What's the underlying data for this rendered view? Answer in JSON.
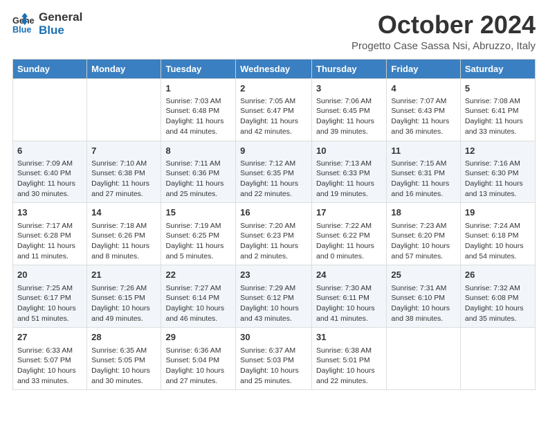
{
  "logo": {
    "line1": "General",
    "line2": "Blue"
  },
  "title": "October 2024",
  "subtitle": "Progetto Case Sassa Nsi, Abruzzo, Italy",
  "days_of_week": [
    "Sunday",
    "Monday",
    "Tuesday",
    "Wednesday",
    "Thursday",
    "Friday",
    "Saturday"
  ],
  "weeks": [
    [
      {
        "day": "",
        "info": ""
      },
      {
        "day": "",
        "info": ""
      },
      {
        "day": "1",
        "info": "Sunrise: 7:03 AM\nSunset: 6:48 PM\nDaylight: 11 hours and 44 minutes."
      },
      {
        "day": "2",
        "info": "Sunrise: 7:05 AM\nSunset: 6:47 PM\nDaylight: 11 hours and 42 minutes."
      },
      {
        "day": "3",
        "info": "Sunrise: 7:06 AM\nSunset: 6:45 PM\nDaylight: 11 hours and 39 minutes."
      },
      {
        "day": "4",
        "info": "Sunrise: 7:07 AM\nSunset: 6:43 PM\nDaylight: 11 hours and 36 minutes."
      },
      {
        "day": "5",
        "info": "Sunrise: 7:08 AM\nSunset: 6:41 PM\nDaylight: 11 hours and 33 minutes."
      }
    ],
    [
      {
        "day": "6",
        "info": "Sunrise: 7:09 AM\nSunset: 6:40 PM\nDaylight: 11 hours and 30 minutes."
      },
      {
        "day": "7",
        "info": "Sunrise: 7:10 AM\nSunset: 6:38 PM\nDaylight: 11 hours and 27 minutes."
      },
      {
        "day": "8",
        "info": "Sunrise: 7:11 AM\nSunset: 6:36 PM\nDaylight: 11 hours and 25 minutes."
      },
      {
        "day": "9",
        "info": "Sunrise: 7:12 AM\nSunset: 6:35 PM\nDaylight: 11 hours and 22 minutes."
      },
      {
        "day": "10",
        "info": "Sunrise: 7:13 AM\nSunset: 6:33 PM\nDaylight: 11 hours and 19 minutes."
      },
      {
        "day": "11",
        "info": "Sunrise: 7:15 AM\nSunset: 6:31 PM\nDaylight: 11 hours and 16 minutes."
      },
      {
        "day": "12",
        "info": "Sunrise: 7:16 AM\nSunset: 6:30 PM\nDaylight: 11 hours and 13 minutes."
      }
    ],
    [
      {
        "day": "13",
        "info": "Sunrise: 7:17 AM\nSunset: 6:28 PM\nDaylight: 11 hours and 11 minutes."
      },
      {
        "day": "14",
        "info": "Sunrise: 7:18 AM\nSunset: 6:26 PM\nDaylight: 11 hours and 8 minutes."
      },
      {
        "day": "15",
        "info": "Sunrise: 7:19 AM\nSunset: 6:25 PM\nDaylight: 11 hours and 5 minutes."
      },
      {
        "day": "16",
        "info": "Sunrise: 7:20 AM\nSunset: 6:23 PM\nDaylight: 11 hours and 2 minutes."
      },
      {
        "day": "17",
        "info": "Sunrise: 7:22 AM\nSunset: 6:22 PM\nDaylight: 11 hours and 0 minutes."
      },
      {
        "day": "18",
        "info": "Sunrise: 7:23 AM\nSunset: 6:20 PM\nDaylight: 10 hours and 57 minutes."
      },
      {
        "day": "19",
        "info": "Sunrise: 7:24 AM\nSunset: 6:18 PM\nDaylight: 10 hours and 54 minutes."
      }
    ],
    [
      {
        "day": "20",
        "info": "Sunrise: 7:25 AM\nSunset: 6:17 PM\nDaylight: 10 hours and 51 minutes."
      },
      {
        "day": "21",
        "info": "Sunrise: 7:26 AM\nSunset: 6:15 PM\nDaylight: 10 hours and 49 minutes."
      },
      {
        "day": "22",
        "info": "Sunrise: 7:27 AM\nSunset: 6:14 PM\nDaylight: 10 hours and 46 minutes."
      },
      {
        "day": "23",
        "info": "Sunrise: 7:29 AM\nSunset: 6:12 PM\nDaylight: 10 hours and 43 minutes."
      },
      {
        "day": "24",
        "info": "Sunrise: 7:30 AM\nSunset: 6:11 PM\nDaylight: 10 hours and 41 minutes."
      },
      {
        "day": "25",
        "info": "Sunrise: 7:31 AM\nSunset: 6:10 PM\nDaylight: 10 hours and 38 minutes."
      },
      {
        "day": "26",
        "info": "Sunrise: 7:32 AM\nSunset: 6:08 PM\nDaylight: 10 hours and 35 minutes."
      }
    ],
    [
      {
        "day": "27",
        "info": "Sunrise: 6:33 AM\nSunset: 5:07 PM\nDaylight: 10 hours and 33 minutes."
      },
      {
        "day": "28",
        "info": "Sunrise: 6:35 AM\nSunset: 5:05 PM\nDaylight: 10 hours and 30 minutes."
      },
      {
        "day": "29",
        "info": "Sunrise: 6:36 AM\nSunset: 5:04 PM\nDaylight: 10 hours and 27 minutes."
      },
      {
        "day": "30",
        "info": "Sunrise: 6:37 AM\nSunset: 5:03 PM\nDaylight: 10 hours and 25 minutes."
      },
      {
        "day": "31",
        "info": "Sunrise: 6:38 AM\nSunset: 5:01 PM\nDaylight: 10 hours and 22 minutes."
      },
      {
        "day": "",
        "info": ""
      },
      {
        "day": "",
        "info": ""
      }
    ]
  ]
}
